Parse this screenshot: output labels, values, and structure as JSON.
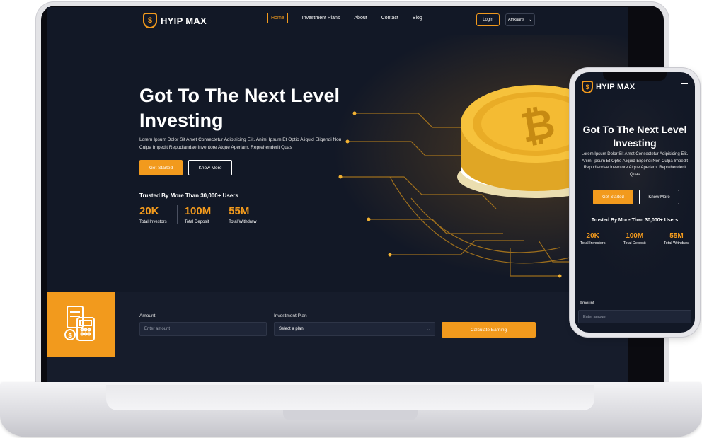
{
  "brand": {
    "name": "HYIP MAX",
    "accent": "#f29a1d",
    "background": "#121826"
  },
  "nav": {
    "items": [
      "Home",
      "Investment Plans",
      "About",
      "Contact",
      "Blog"
    ],
    "active": "Home",
    "login_label": "Login",
    "language": "Afrikaans"
  },
  "hero": {
    "title_line1": "Got To The Next Level",
    "title_line2": "Investing",
    "description": "Lorem Ipsum Dolor Sit Amet Consectetur Adipisicing Elit. Animi Ipsum Et Optio Aliquid Eligendi Non Culpa Impedit Repudiandae Inventore Atque Aperiam, Reprehenderit Quas",
    "primary_button": "Get Started",
    "secondary_button": "Know More",
    "trusted_text": "Trusted By More Than 30,000+ Users",
    "stats": [
      {
        "value": "20K",
        "label": "Total Investors"
      },
      {
        "value": "100M",
        "label": "Total Deposit"
      },
      {
        "value": "55M",
        "label": "Total Withdraw"
      }
    ]
  },
  "calculator": {
    "amount_label": "Amount",
    "amount_placeholder": "Enter amount",
    "plan_label": "Investment Plan",
    "plan_value": "Select a plan",
    "button_label": "Calculate Earning"
  },
  "mobile": {
    "title": "Got To The Next Level Investing",
    "amount_label": "Amount",
    "amount_placeholder": "Enter amount"
  }
}
